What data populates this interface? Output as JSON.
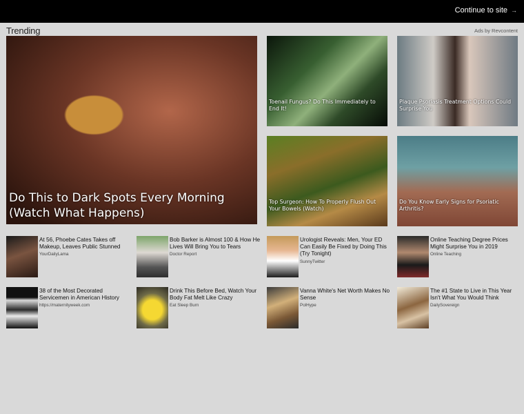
{
  "topbar": {
    "continue_label": "Continue to site",
    "arrow": "→"
  },
  "header": {
    "title": "Trending",
    "ads_by": "Ads by Revcontent"
  },
  "featured": [
    {
      "caption": "Do This to Dark Spots Every Morning (Watch What Happens)"
    },
    {
      "caption": "Toenail Fungus? Do This Immediately to End It!"
    },
    {
      "caption": "Plaque Psoriasis Treatment Options Could Surprise You"
    },
    {
      "caption": "Top Surgeon: How To Properly Flush Out Your Bowels (Watch)"
    },
    {
      "caption": "Do You Know Early Signs for Psoriatic Arthritis?"
    }
  ],
  "items": [
    {
      "title": "At 56, Phoebe Cates Takes off Makeup, Leaves Public Stunned",
      "source": "YourDailyLama"
    },
    {
      "title": "Bob Barker is Almost 100 & How He Lives Will Bring You to Tears",
      "source": "Doctor Report"
    },
    {
      "title": "Urologist Reveals: Men, Your ED Can Easily Be Fixed by Doing This (Try Tonight)",
      "source": "SunnyTwitter"
    },
    {
      "title": "Online Teaching Degree Prices Might Surprise You in 2019",
      "source": "Online Teaching"
    },
    {
      "title": "38 of the Most Decorated Servicemen in American History",
      "source": "https://maternityweek.com"
    },
    {
      "title": "Drink This Before Bed, Watch Your Body Fat Melt Like Crazy",
      "source": "Eat Sleep Burn"
    },
    {
      "title": "Vanna White's Net Worth Makes No Sense",
      "source": "PolHype"
    },
    {
      "title": "The #1 State to Live in This Year Isn't What You Would Think",
      "source": "DailySovereign"
    }
  ]
}
